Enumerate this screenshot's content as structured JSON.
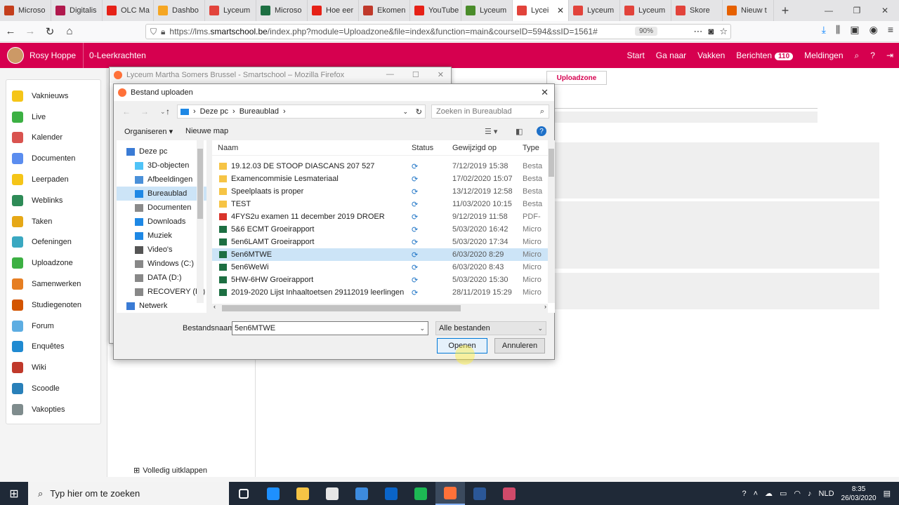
{
  "browser": {
    "tabs": [
      {
        "label": "Microso",
        "color": "#c43e1c"
      },
      {
        "label": "Digitalis",
        "color": "#b0194d"
      },
      {
        "label": "OLC Ma",
        "color": "#e62117"
      },
      {
        "label": "Dashbo",
        "color": "#f5a623"
      },
      {
        "label": "Lyceum",
        "color": "#e2433b"
      },
      {
        "label": "Microso",
        "color": "#1d6f42"
      },
      {
        "label": "Hoe eer",
        "color": "#e62117"
      },
      {
        "label": "Ekomen",
        "color": "#c0392b"
      },
      {
        "label": "YouTube",
        "color": "#e62117"
      },
      {
        "label": "Lyceum",
        "color": "#4a8c2a"
      },
      {
        "label": "Lycei",
        "color": "#e2433b",
        "active": true
      },
      {
        "label": "Lyceum",
        "color": "#e2433b"
      },
      {
        "label": "Lyceum",
        "color": "#e2433b"
      },
      {
        "label": "Skore",
        "color": "#e2433b"
      },
      {
        "label": "Nieuw t",
        "color": "#e66000"
      }
    ],
    "url_prefix": "https://lms.",
    "url_domain": "smartschool.be",
    "url_suffix": "/index.php?module=Uploadzone&file=index&function=main&courseID=594&ssID=1561#",
    "zoom": "90%"
  },
  "site": {
    "user_name": "Rosy Hoppe",
    "group": "0-Leerkrachten",
    "nav": [
      "Start",
      "Ga naar",
      "Vakken",
      "Berichten",
      "Meldingen"
    ],
    "messages_count": "110",
    "uploadzone_tab": "Uploadzone",
    "expand_label": "Volledig uitklappen"
  },
  "sidebar": {
    "items": [
      {
        "label": "Vaknieuws",
        "color": "#f5c518"
      },
      {
        "label": "Live",
        "color": "#3cb043"
      },
      {
        "label": "Kalender",
        "color": "#d9534f"
      },
      {
        "label": "Documenten",
        "color": "#5b8def"
      },
      {
        "label": "Leerpaden",
        "color": "#f5c518"
      },
      {
        "label": "Weblinks",
        "color": "#2e8b57"
      },
      {
        "label": "Taken",
        "color": "#e6a817"
      },
      {
        "label": "Oefeningen",
        "color": "#3aa8c1"
      },
      {
        "label": "Uploadzone",
        "color": "#3cb043"
      },
      {
        "label": "Samenwerken",
        "color": "#e67e22"
      },
      {
        "label": "Studiegenoten",
        "color": "#d35400"
      },
      {
        "label": "Forum",
        "color": "#5dade2"
      },
      {
        "label": "Enquêtes",
        "color": "#1f8ad1"
      },
      {
        "label": "Wiki",
        "color": "#c0392b"
      },
      {
        "label": "Scoodle",
        "color": "#2980b9"
      },
      {
        "label": "Vakopties",
        "color": "#7f8c8d"
      }
    ]
  },
  "firefox_window": {
    "title": "Lyceum Martha Somers Brussel - Smartschool – Mozilla Firefox"
  },
  "dialog": {
    "title": "Bestand uploaden",
    "path": [
      "Deze pc",
      "Bureaublad"
    ],
    "search_placeholder": "Zoeken in Bureaublad",
    "organize": "Organiseren",
    "new_folder": "Nieuwe map",
    "tree": [
      {
        "label": "Deze pc",
        "indent": 0,
        "color": "#3a7bd5"
      },
      {
        "label": "3D-objecten",
        "indent": 1,
        "color": "#4fc3f7"
      },
      {
        "label": "Afbeeldingen",
        "indent": 1,
        "color": "#4a90d9"
      },
      {
        "label": "Bureaublad",
        "indent": 1,
        "color": "#1e88e5",
        "selected": true
      },
      {
        "label": "Documenten",
        "indent": 1,
        "color": "#8a8a8a"
      },
      {
        "label": "Downloads",
        "indent": 1,
        "color": "#1e88e5"
      },
      {
        "label": "Muziek",
        "indent": 1,
        "color": "#1e88e5"
      },
      {
        "label": "Video's",
        "indent": 1,
        "color": "#555"
      },
      {
        "label": "Windows (C:)",
        "indent": 1,
        "color": "#888"
      },
      {
        "label": "DATA (D:)",
        "indent": 1,
        "color": "#888"
      },
      {
        "label": "RECOVERY (E:)",
        "indent": 1,
        "color": "#888"
      },
      {
        "label": "Netwerk",
        "indent": 0,
        "color": "#3a7bd5"
      }
    ],
    "columns": [
      "Naam",
      "Status",
      "Gewijzigd op",
      "Type"
    ],
    "files": [
      {
        "name": "19.12.03 DE STOOP DIASCANS 207 527",
        "date": "7/12/2019 15:38",
        "type": "Besta",
        "kind": "folder"
      },
      {
        "name": "Examencommisie Lesmateriaal",
        "date": "17/02/2020 15:07",
        "type": "Besta",
        "kind": "folder"
      },
      {
        "name": "Speelplaats is proper",
        "date": "13/12/2019 12:58",
        "type": "Besta",
        "kind": "folder"
      },
      {
        "name": "TEST",
        "date": "11/03/2020 10:15",
        "type": "Besta",
        "kind": "folder"
      },
      {
        "name": "4FYS2u examen 11 december 2019 DROER",
        "date": "9/12/2019 11:58",
        "type": "PDF-",
        "kind": "pdf"
      },
      {
        "name": "5&6 ECMT Groeirapport",
        "date": "5/03/2020 16:42",
        "type": "Micro",
        "kind": "xls"
      },
      {
        "name": "5en6LAMT Groeirapport",
        "date": "5/03/2020 17:34",
        "type": "Micro",
        "kind": "xls"
      },
      {
        "name": "5en6MTWE",
        "date": "6/03/2020 8:29",
        "type": "Micro",
        "kind": "xls",
        "selected": true
      },
      {
        "name": "5en6WeWi",
        "date": "6/03/2020 8:43",
        "type": "Micro",
        "kind": "xls"
      },
      {
        "name": "5HW-6HW Groeirapport",
        "date": "5/03/2020 15:30",
        "type": "Micro",
        "kind": "xls"
      },
      {
        "name": "2019-2020 Lijst Inhaaltoetsen 29112019 leerlingen",
        "date": "28/11/2019 15:29",
        "type": "Micro",
        "kind": "xls"
      }
    ],
    "filename_label": "Bestandsnaam:",
    "filename_value": "5en6MTWE",
    "filetype": "Alle bestanden",
    "open_label": "Openen",
    "cancel_label": "Annuleren"
  },
  "taskbar": {
    "search_placeholder": "Typ hier om te zoeken",
    "apps": [
      {
        "name": "task-view",
        "color": "#ffffff"
      },
      {
        "name": "edge",
        "color": "#1e90ff"
      },
      {
        "name": "file-explorer",
        "color": "#f6c445"
      },
      {
        "name": "store",
        "color": "#e6e6e6"
      },
      {
        "name": "mail",
        "color": "#3d8bde"
      },
      {
        "name": "outlook",
        "color": "#0a64c8"
      },
      {
        "name": "spotify",
        "color": "#1db954"
      },
      {
        "name": "firefox",
        "color": "#ff7139",
        "active": true
      },
      {
        "name": "word",
        "color": "#2b5797"
      },
      {
        "name": "snipping",
        "color": "#d04a6a"
      }
    ],
    "lang": "NLD",
    "time": "8:35",
    "date": "26/03/2020"
  }
}
